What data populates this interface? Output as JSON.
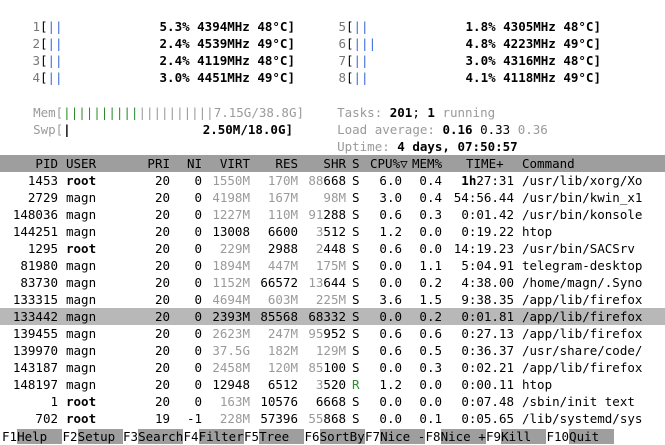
{
  "cpus": [
    {
      "id": "1",
      "pct": "5.3%",
      "freq": "4394MHz",
      "temp": "48°C]"
    },
    {
      "id": "2",
      "pct": "2.4%",
      "freq": "4539MHz",
      "temp": "49°C]"
    },
    {
      "id": "3",
      "pct": "2.4%",
      "freq": "4119MHz",
      "temp": "48°C]"
    },
    {
      "id": "4",
      "pct": "3.0%",
      "freq": "4451MHz",
      "temp": "49°C]"
    },
    {
      "id": "5",
      "pct": "1.8%",
      "freq": "4305MHz",
      "temp": "48°C]"
    },
    {
      "id": "6",
      "pct": "4.8%",
      "freq": "4223MHz",
      "temp": "49°C]"
    },
    {
      "id": "7",
      "pct": "3.0%",
      "freq": "4316MHz",
      "temp": "48°C]"
    },
    {
      "id": "8",
      "pct": "4.1%",
      "freq": "4118MHz",
      "temp": "49°C]"
    }
  ],
  "mem": {
    "label": "Mem",
    "value": "7.15G/38.8G]"
  },
  "swp": {
    "label": "Swp",
    "value": "2.50M/18.0G]"
  },
  "tasks": {
    "label": "Tasks:",
    "count": "201",
    "sep": ";",
    "running": "1",
    "running_label": "running"
  },
  "load": {
    "label": "Load average:",
    "v1": "0.16",
    "v5": "0.33",
    "v15": "0.36"
  },
  "uptime": {
    "label": "Uptime:",
    "value": "4 days, 07:50:57"
  },
  "columns": [
    "PID",
    "USER",
    "PRI",
    "NI",
    "VIRT",
    "RES",
    "SHR",
    "S",
    "CPU%",
    "MEM%",
    "TIME+",
    "Command"
  ],
  "processes": [
    {
      "pid": "1453",
      "user": "root",
      "pri": "20",
      "ni": "0",
      "virt": "1550M",
      "res": "170M",
      "shr_hi": "88",
      "shr_lo": "668",
      "s": "S",
      "cpu": "6.0",
      "mem": "0.4",
      "time_hi": "1h",
      "time_lo": "27:31",
      "cmd": "/usr/lib/xorg/Xo"
    },
    {
      "pid": "2729",
      "user": "magn",
      "pri": "20",
      "ni": "0",
      "virt": "4198M",
      "res": "167M",
      "shr_hi": "",
      "shr_lo": "98M",
      "s": "S",
      "cpu": "3.0",
      "mem": "0.4",
      "time_hi": "",
      "time_lo": "54:56.44",
      "cmd": "/usr/bin/kwin_x1"
    },
    {
      "pid": "148036",
      "user": "magn",
      "pri": "20",
      "ni": "0",
      "virt": "1227M",
      "res": "110M",
      "shr_hi": "91",
      "shr_lo": "288",
      "s": "S",
      "cpu": "0.6",
      "mem": "0.3",
      "time_hi": "",
      "time_lo": "0:01.42",
      "cmd": "/usr/bin/konsole"
    },
    {
      "pid": "144251",
      "user": "magn",
      "pri": "20",
      "ni": "0",
      "virt": "13008",
      "res": "6600",
      "shr_hi": "3",
      "shr_lo": "512",
      "s": "S",
      "cpu": "1.2",
      "mem": "0.0",
      "time_hi": "",
      "time_lo": "0:19.22",
      "cmd": "htop"
    },
    {
      "pid": "1295",
      "user": "root",
      "pri": "20",
      "ni": "0",
      "virt": "229M",
      "res": "2988",
      "shr_hi": "2",
      "shr_lo": "448",
      "s": "S",
      "cpu": "0.6",
      "mem": "0.0",
      "time_hi": "",
      "time_lo": "14:19.23",
      "cmd": "/usr/bin/SACSrv"
    },
    {
      "pid": "81980",
      "user": "magn",
      "pri": "20",
      "ni": "0",
      "virt": "1894M",
      "res": "447M",
      "shr_hi": "",
      "shr_lo": "175M",
      "s": "S",
      "cpu": "0.0",
      "mem": "1.1",
      "time_hi": "",
      "time_lo": "5:04.91",
      "cmd": "telegram-desktop"
    },
    {
      "pid": "83730",
      "user": "magn",
      "pri": "20",
      "ni": "0",
      "virt": "1152M",
      "res": "66572",
      "shr_hi": "13",
      "shr_lo": "644",
      "s": "S",
      "cpu": "0.0",
      "mem": "0.2",
      "time_hi": "",
      "time_lo": "4:38.00",
      "cmd": "/home/magn/.Syno"
    },
    {
      "pid": "133315",
      "user": "magn",
      "pri": "20",
      "ni": "0",
      "virt": "4694M",
      "res": "603M",
      "shr_hi": "",
      "shr_lo": "225M",
      "s": "S",
      "cpu": "3.6",
      "mem": "1.5",
      "time_hi": "",
      "time_lo": "9:38.35",
      "cmd": "/app/lib/firefox"
    },
    {
      "pid": "133442",
      "user": "magn",
      "pri": "20",
      "ni": "0",
      "virt": "2393M",
      "res": "85568",
      "shr_hi": "",
      "shr_lo": "68332",
      "s": "S",
      "cpu": "0.0",
      "mem": "0.2",
      "time_hi": "",
      "time_lo": "0:01.81",
      "cmd": "/app/lib/firefox",
      "selected": true
    },
    {
      "pid": "139455",
      "user": "magn",
      "pri": "20",
      "ni": "0",
      "virt": "2623M",
      "res": "247M",
      "shr_hi": "95",
      "shr_lo": "952",
      "s": "S",
      "cpu": "0.6",
      "mem": "0.6",
      "time_hi": "",
      "time_lo": "0:27.13",
      "cmd": "/app/lib/firefox"
    },
    {
      "pid": "139970",
      "user": "magn",
      "pri": "20",
      "ni": "0",
      "virt": "37.5G",
      "res": "182M",
      "shr_hi": "",
      "shr_lo": "129M",
      "s": "S",
      "cpu": "0.6",
      "mem": "0.5",
      "time_hi": "",
      "time_lo": "0:36.37",
      "cmd": "/usr/share/code/"
    },
    {
      "pid": "143187",
      "user": "magn",
      "pri": "20",
      "ni": "0",
      "virt": "2458M",
      "res": "120M",
      "shr_hi": "85",
      "shr_lo": "100",
      "s": "S",
      "cpu": "0.0",
      "mem": "0.3",
      "time_hi": "",
      "time_lo": "0:02.21",
      "cmd": "/app/lib/firefox"
    },
    {
      "pid": "148197",
      "user": "magn",
      "pri": "20",
      "ni": "0",
      "virt": "12948",
      "res": "6512",
      "shr_hi": "3",
      "shr_lo": "520",
      "s": "R",
      "cpu": "1.2",
      "mem": "0.0",
      "time_hi": "",
      "time_lo": "0:00.11",
      "cmd": "htop"
    },
    {
      "pid": "1",
      "user": "root",
      "pri": "20",
      "ni": "0",
      "virt": "163M",
      "res": "10576",
      "shr_hi": "",
      "shr_lo": "6668",
      "s": "S",
      "cpu": "0.0",
      "mem": "0.0",
      "time_hi": "",
      "time_lo": "0:07.48",
      "cmd": "/sbin/init text"
    },
    {
      "pid": "702",
      "user": "root",
      "pri": "19",
      "ni": "-1",
      "virt": "228M",
      "res": "57396",
      "shr_hi": "55",
      "shr_lo": "868",
      "s": "S",
      "cpu": "0.0",
      "mem": "0.1",
      "time_hi": "",
      "time_lo": "0:05.65",
      "cmd": "/lib/systemd/sys"
    }
  ],
  "footer": [
    {
      "key": "F1",
      "label": "Help  "
    },
    {
      "key": "F2",
      "label": "Setup "
    },
    {
      "key": "F3",
      "label": "Search"
    },
    {
      "key": "F4",
      "label": "Filter"
    },
    {
      "key": "F5",
      "label": "Tree  "
    },
    {
      "key": "F6",
      "label": "SortBy"
    },
    {
      "key": "F7",
      "label": "Nice -"
    },
    {
      "key": "F8",
      "label": "Nice +"
    },
    {
      "key": "F9",
      "label": "Kill  "
    },
    {
      "key": "F10",
      "label": "Quit  "
    }
  ],
  "colors": {
    "header_bg": "#9e9e9e",
    "selected_bg": "#b8b8b8",
    "bar_blue": "#3a6bd6",
    "bar_green": "#2e8b2e"
  }
}
